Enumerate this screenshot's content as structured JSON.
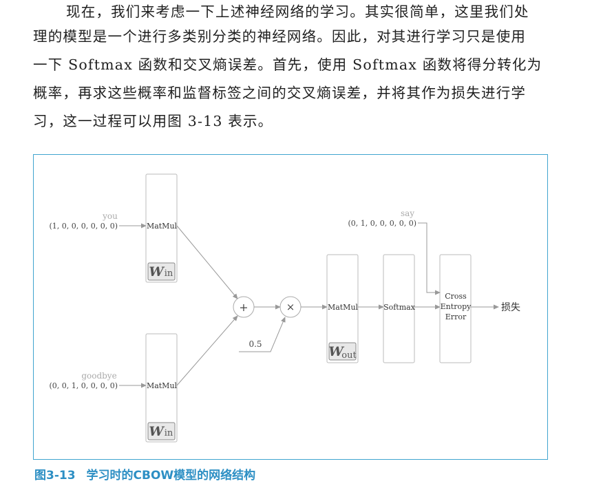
{
  "paragraph": {
    "lines": [
      "现在，我们来考虑一下上述神经网络的学习。其实很简单，这里我们处",
      "理的模型是一个进行多类别分类的神经网络。因此，对其进行学习只是使用",
      "一下 Softmax 函数和交叉熵误差。首先，使用 Softmax 函数将得分转化为",
      "概率，再求这些概率和监督标签之间的交叉熵误差，并将其作为损失进行学",
      "习，这一过程可以用图 3-13 表示。"
    ]
  },
  "figure": {
    "inputs": {
      "top": {
        "word": "you",
        "vector": "(1, 0, 0, 0, 0, 0, 0)"
      },
      "bottom": {
        "word": "goodbye",
        "vector": "(0, 0, 1, 0, 0, 0, 0)"
      }
    },
    "target": {
      "word": "say",
      "vector": "(0, 1, 0, 0, 0, 0, 0)"
    },
    "layers": {
      "matmul_label": "MatMul",
      "w_in_main": "W",
      "w_in_sub": "in",
      "w_out_main": "W",
      "w_out_sub": "out",
      "softmax": "Softmax",
      "cross_entropy": [
        "Cross",
        "Entropy",
        "Error"
      ],
      "add_symbol": "+",
      "mul_symbol": "×",
      "scale": "0.5",
      "loss": "损失"
    },
    "colors": {
      "border": "#3fa4cf",
      "caption": "#2d8fc4",
      "arrow": "#999999"
    }
  },
  "caption": {
    "number": "图3-13",
    "text": "学习时的CBOW模型的网络结构"
  }
}
